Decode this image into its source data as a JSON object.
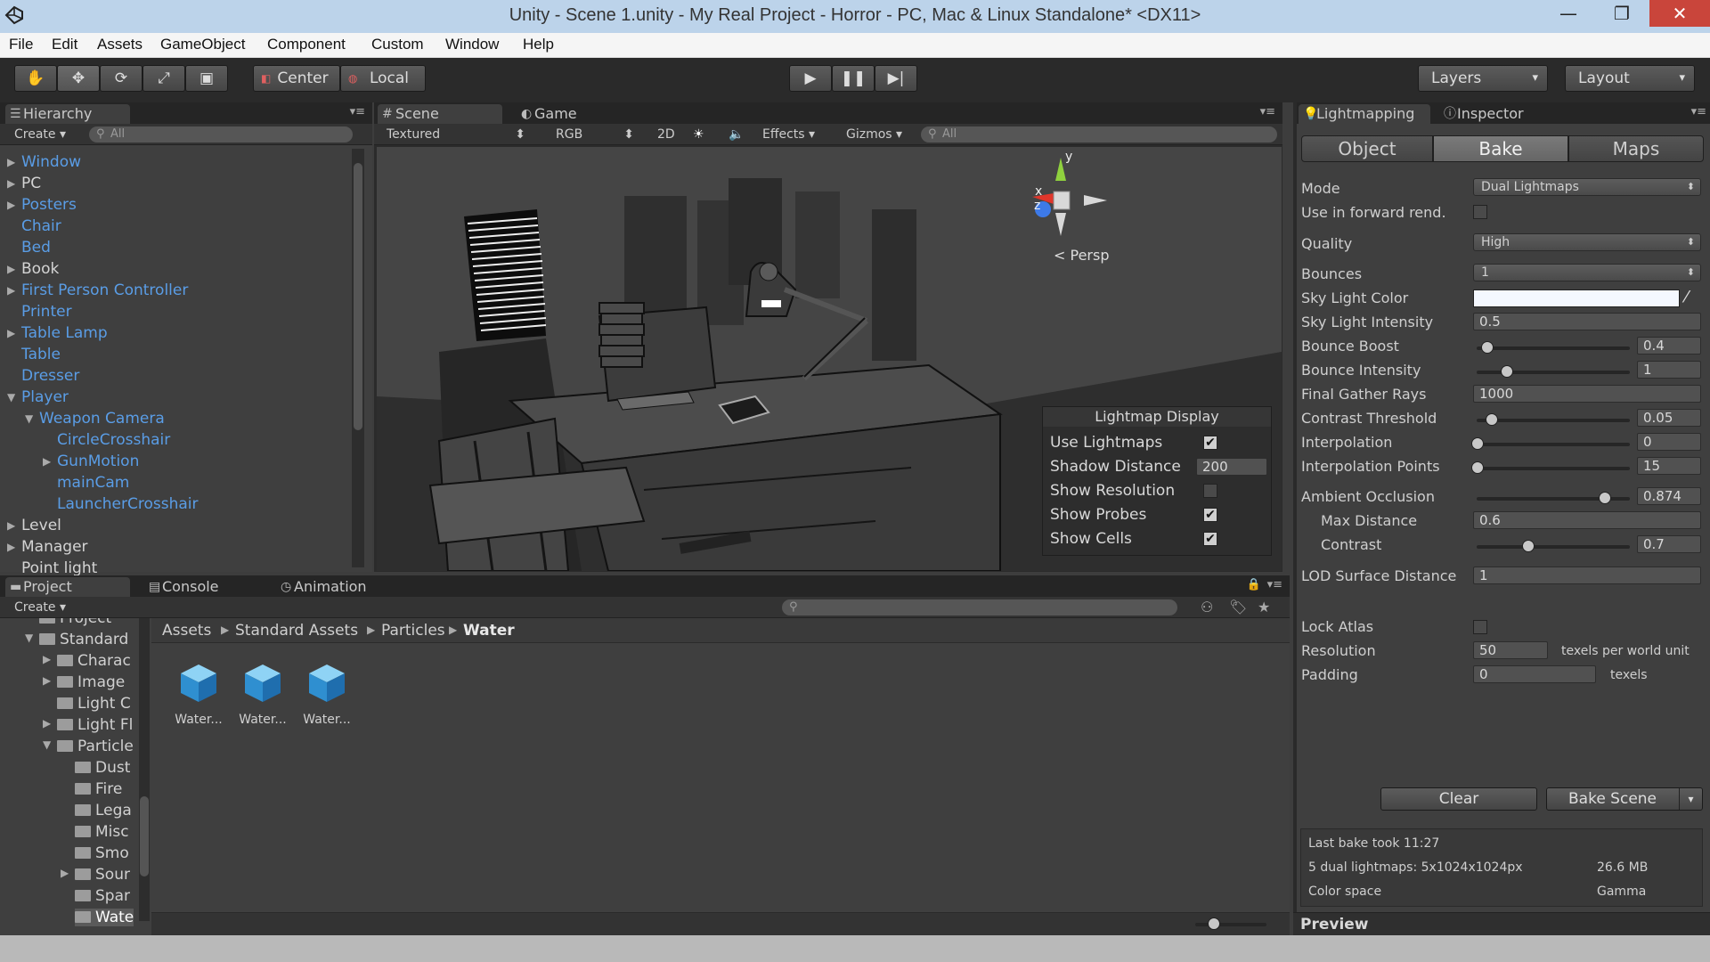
{
  "window": {
    "title": "Unity - Scene 1.unity - My Real Project - Horror - PC, Mac & Linux Standalone* <DX11>",
    "controls": {
      "minimize": "—",
      "maximize": "❐",
      "close": "✕"
    }
  },
  "menu": [
    "File",
    "Edit",
    "Assets",
    "GameObject",
    "Component",
    "Custom",
    "Window",
    "Help"
  ],
  "toolbar": {
    "pivot": "Center",
    "space": "Local",
    "layers": "Layers",
    "layout": "Layout"
  },
  "hierarchy": {
    "tab": "Hierarchy",
    "create": "Create",
    "search_placeholder": "All",
    "items": [
      {
        "label": "Window",
        "expandable": true,
        "prefab": true,
        "depth": 0
      },
      {
        "label": "PC",
        "expandable": true,
        "prefab": false,
        "depth": 0
      },
      {
        "label": "Posters",
        "expandable": true,
        "prefab": true,
        "depth": 0
      },
      {
        "label": "Chair",
        "expandable": false,
        "prefab": true,
        "depth": 0
      },
      {
        "label": "Bed",
        "expandable": false,
        "prefab": true,
        "depth": 0
      },
      {
        "label": "Book",
        "expandable": true,
        "prefab": false,
        "depth": 0
      },
      {
        "label": "First Person Controller",
        "expandable": true,
        "prefab": true,
        "depth": 0
      },
      {
        "label": "Printer",
        "expandable": false,
        "prefab": true,
        "depth": 0
      },
      {
        "label": "Table Lamp",
        "expandable": true,
        "prefab": true,
        "depth": 0
      },
      {
        "label": "Table",
        "expandable": false,
        "prefab": true,
        "depth": 0
      },
      {
        "label": "Dresser",
        "expandable": false,
        "prefab": true,
        "depth": 0
      },
      {
        "label": "Player",
        "expandable": true,
        "prefab": true,
        "depth": 0
      },
      {
        "label": "Weapon Camera",
        "expandable": true,
        "prefab": true,
        "depth": 1
      },
      {
        "label": "CircleCrosshair",
        "expandable": false,
        "prefab": true,
        "depth": 2
      },
      {
        "label": "GunMotion",
        "expandable": true,
        "prefab": true,
        "depth": 2
      },
      {
        "label": "mainCam",
        "expandable": false,
        "prefab": true,
        "depth": 2
      },
      {
        "label": "LauncherCrosshair",
        "expandable": false,
        "prefab": true,
        "depth": 2
      },
      {
        "label": "Level",
        "expandable": true,
        "prefab": false,
        "depth": 0
      },
      {
        "label": "Manager",
        "expandable": true,
        "prefab": false,
        "depth": 0
      },
      {
        "label": "Point light",
        "expandable": false,
        "prefab": false,
        "depth": 0
      }
    ]
  },
  "scene": {
    "tabs": {
      "scene": "Scene",
      "game": "Game"
    },
    "shading": "Textured",
    "render_mode": "RGB",
    "mode_2d": "2D",
    "effects": "Effects",
    "gizmos": "Gizmos",
    "search_placeholder": "All",
    "gizmo": {
      "y": "y",
      "x": "x",
      "z": "z",
      "projection": "Persp"
    }
  },
  "lightmap_display": {
    "title": "Lightmap Display",
    "use_lightmaps": {
      "label": "Use Lightmaps",
      "checked": true
    },
    "shadow_distance": {
      "label": "Shadow Distance",
      "value": "200"
    },
    "show_resolution": {
      "label": "Show Resolution",
      "checked": false
    },
    "show_probes": {
      "label": "Show Probes",
      "checked": true
    },
    "show_cells": {
      "label": "Show Cells",
      "checked": true
    }
  },
  "inspector": {
    "tabs": {
      "lightmapping": "Lightmapping",
      "inspector": "Inspector"
    },
    "segments": [
      "Object",
      "Bake",
      "Maps"
    ],
    "active_segment": "Bake",
    "mode": {
      "label": "Mode",
      "value": "Dual Lightmaps"
    },
    "forward": {
      "label": "Use in forward rend.",
      "checked": false
    },
    "quality": {
      "label": "Quality",
      "value": "High"
    },
    "bounces": {
      "label": "Bounces",
      "value": "1"
    },
    "sky_color": {
      "label": "Sky Light Color",
      "color": "#f4f8ff"
    },
    "sky_intensity": {
      "label": "Sky Light Intensity",
      "value": "0.5"
    },
    "bounce_boost": {
      "label": "Bounce Boost",
      "value": "0.4",
      "fraction": 0.07
    },
    "bounce_intensity": {
      "label": "Bounce Intensity",
      "value": "1",
      "fraction": 0.2
    },
    "final_gather": {
      "label": "Final Gather Rays",
      "value": "1000"
    },
    "contrast_threshold": {
      "label": "Contrast Threshold",
      "value": "0.05",
      "fraction": 0.1
    },
    "interpolation": {
      "label": "Interpolation",
      "value": "0",
      "fraction": 0.0
    },
    "interpolation_points": {
      "label": "Interpolation Points",
      "value": "15",
      "fraction": 0.0
    },
    "ambient_occlusion": {
      "label": "Ambient Occlusion",
      "value": "0.874",
      "fraction": 0.874
    },
    "max_distance": {
      "label": "Max Distance",
      "value": "0.6"
    },
    "contrast": {
      "label": "Contrast",
      "value": "0.7",
      "fraction": 0.35
    },
    "lod_distance": {
      "label": "LOD Surface Distance",
      "value": "1"
    },
    "lock_atlas": {
      "label": "Lock Atlas",
      "checked": false
    },
    "resolution": {
      "label": "Resolution",
      "value": "50",
      "unit": "texels per world unit"
    },
    "padding": {
      "label": "Padding",
      "value": "0",
      "unit": "texels"
    },
    "clear": "Clear",
    "bake_scene": "Bake Scene",
    "stats": {
      "last_bake": "Last bake took 11:27",
      "lightmaps": "5 dual lightmaps: 5x1024x1024px",
      "size": "26.6 MB",
      "color_space_label": "Color space",
      "color_space": "Gamma"
    },
    "preview": "Preview"
  },
  "project": {
    "tabs": {
      "project": "Project",
      "console": "Console",
      "animation": "Animation"
    },
    "create": "Create",
    "tree": [
      {
        "label": "Project",
        "depth": 1,
        "arrow": ""
      },
      {
        "label": "Standard",
        "depth": 1,
        "arrow": "▼"
      },
      {
        "label": "Charac",
        "depth": 2,
        "arrow": "▶"
      },
      {
        "label": "Image",
        "depth": 2,
        "arrow": "▶"
      },
      {
        "label": "Light C",
        "depth": 2,
        "arrow": ""
      },
      {
        "label": "Light Fl",
        "depth": 2,
        "arrow": "▶"
      },
      {
        "label": "Particle",
        "depth": 2,
        "arrow": "▼"
      },
      {
        "label": "Dust",
        "depth": 3,
        "arrow": ""
      },
      {
        "label": "Fire",
        "depth": 3,
        "arrow": ""
      },
      {
        "label": "Lega",
        "depth": 3,
        "arrow": ""
      },
      {
        "label": "Misc",
        "depth": 3,
        "arrow": ""
      },
      {
        "label": "Smo",
        "depth": 3,
        "arrow": ""
      },
      {
        "label": "Sour",
        "depth": 3,
        "arrow": "▶"
      },
      {
        "label": "Spar",
        "depth": 3,
        "arrow": ""
      },
      {
        "label": "Wate",
        "depth": 3,
        "arrow": ""
      }
    ],
    "breadcrumb": [
      "Assets",
      "Standard Assets",
      "Particles",
      "Water"
    ],
    "assets": [
      "Water...",
      "Water...",
      "Water..."
    ]
  }
}
